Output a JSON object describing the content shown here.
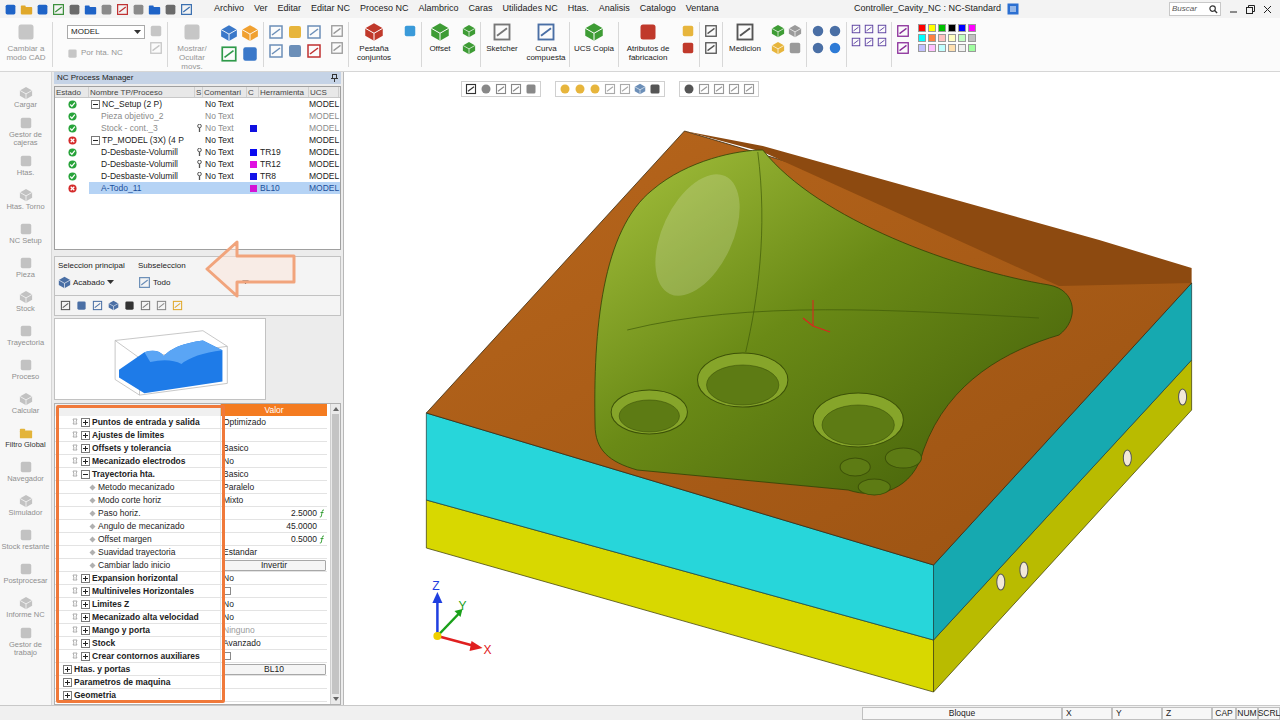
{
  "window": {
    "title": "Controller_Cavity_NC : NC-Standard"
  },
  "menu": [
    "Archivo",
    "Ver",
    "Editar",
    "Editar NC",
    "Proceso NC",
    "Alambrico",
    "Caras",
    "Utilidades NC",
    "Htas.",
    "Analisis",
    "Catalogo",
    "Ventana"
  ],
  "search": {
    "placeholder": "Buscar"
  },
  "ribbon": {
    "mode_button": {
      "label": "Cambiar a modo CAD",
      "disabled": true
    },
    "model_select": "MODEL",
    "tool_filter": {
      "label": "Por hta. NC",
      "disabled": true
    },
    "tools": [
      {
        "label": "Mostrar/ Ocultar movs.",
        "disabled": true
      },
      {
        "label": "Pestaña conjuntos",
        "disabled": false
      },
      {
        "label": "Offset",
        "disabled": false
      },
      {
        "label": "Sketcher",
        "disabled": false
      },
      {
        "label": "Curva compuesta",
        "disabled": false
      },
      {
        "label": "UCS Copia",
        "disabled": false
      },
      {
        "label": "Atributos de fabricacion",
        "disabled": false
      },
      {
        "label": "Medicion",
        "disabled": false
      }
    ]
  },
  "sidebar": {
    "items": [
      {
        "label": "Cargar",
        "enabled": false
      },
      {
        "label": "Gestor de cajeras",
        "enabled": false
      },
      {
        "label": "Htas.",
        "enabled": false
      },
      {
        "label": "Htas. Torno",
        "enabled": false
      },
      {
        "label": "NC Setup",
        "enabled": false
      },
      {
        "label": "Pieza",
        "enabled": false
      },
      {
        "label": "Stock",
        "enabled": false
      },
      {
        "label": "Trayectoria",
        "enabled": false
      },
      {
        "label": "Proceso",
        "enabled": false
      },
      {
        "label": "Calcular",
        "enabled": false
      },
      {
        "label": "Filtro Global",
        "enabled": true
      },
      {
        "label": "Navegador",
        "enabled": false
      },
      {
        "label": "Simulador",
        "enabled": false
      },
      {
        "label": "Stock restante",
        "enabled": false
      },
      {
        "label": "Postprocesar",
        "enabled": false
      },
      {
        "label": "Informe NC",
        "enabled": false
      },
      {
        "label": "Gestor de trabajo",
        "enabled": false
      }
    ]
  },
  "process_manager": {
    "title": "NC Process Manager",
    "columns": [
      "Estado",
      "Nombre TP/Proceso",
      "S",
      "Comentari",
      "C",
      "Herramienta",
      "UCS"
    ],
    "rows": [
      {
        "status": "ok",
        "name": "NC_Setup (2 P)",
        "depth": 0,
        "group": true,
        "expanded": true,
        "wrench": false,
        "comment": "No Text",
        "color": null,
        "tool": "",
        "ucs": "MODEL",
        "disabled": false,
        "selected": false
      },
      {
        "status": "ok",
        "name": "Pieza objetivo_2",
        "depth": 1,
        "group": false,
        "expanded": false,
        "wrench": false,
        "comment": "No Text",
        "color": null,
        "tool": "",
        "ucs": "MODEL",
        "disabled": true,
        "selected": false
      },
      {
        "status": "ok",
        "name": "Stock - cont._3",
        "depth": 1,
        "group": false,
        "expanded": false,
        "wrench": true,
        "comment": "No Text",
        "color": "#1010e0",
        "tool": "",
        "ucs": "MODEL",
        "disabled": true,
        "selected": false
      },
      {
        "status": "error",
        "name": "TP_MODEL (3X) (4 P",
        "depth": 0,
        "group": true,
        "expanded": true,
        "wrench": false,
        "comment": "No Text",
        "color": null,
        "tool": "",
        "ucs": "MODEL",
        "disabled": false,
        "selected": false
      },
      {
        "status": "ok",
        "name": "D-Desbaste-Volumill",
        "depth": 1,
        "group": false,
        "expanded": false,
        "wrench": true,
        "comment": "No Text",
        "color": "#0a0af0",
        "tool": "TR19",
        "ucs": "MODEL",
        "disabled": false,
        "selected": false
      },
      {
        "status": "ok",
        "name": "D-Desbaste-Volumill",
        "depth": 1,
        "group": false,
        "expanded": false,
        "wrench": true,
        "comment": "No Text",
        "color": "#e010e0",
        "tool": "TR12",
        "ucs": "MODEL",
        "disabled": false,
        "selected": false
      },
      {
        "status": "ok",
        "name": "D-Desbaste-Volumill",
        "depth": 1,
        "group": false,
        "expanded": false,
        "wrench": true,
        "comment": "No Text",
        "color": "#1414e8",
        "tool": "TR8",
        "ucs": "MODEL",
        "disabled": false,
        "selected": false
      },
      {
        "status": "error",
        "name": "A-Todo_11",
        "depth": 1,
        "group": false,
        "expanded": false,
        "wrench": false,
        "comment": "",
        "color": "#d414d4",
        "tool": "BL10",
        "ucs": "MODEL",
        "disabled": false,
        "selected": true
      }
    ]
  },
  "selection": {
    "primary_label": "Seleccion principal",
    "primary_value": "Acabado",
    "sub_label": "Subseleccion",
    "sub_value": "Todo"
  },
  "property_grid": {
    "value_header": "Valor",
    "rows": [
      {
        "label": "Puntos de entrada y salida",
        "value": "Optimizado",
        "kind": "group",
        "depth": 1,
        "expanded": false,
        "value_kind": "text",
        "checked": false,
        "formula": false,
        "disabled": false
      },
      {
        "label": "Ajustes de limites",
        "value": "",
        "kind": "group",
        "depth": 1,
        "expanded": false,
        "value_kind": "none",
        "checked": false,
        "formula": false,
        "disabled": false
      },
      {
        "label": "Offsets y tolerancia",
        "value": "Basico",
        "kind": "group",
        "depth": 1,
        "expanded": false,
        "value_kind": "text",
        "checked": false,
        "formula": false,
        "disabled": false
      },
      {
        "label": "Mecanizado electrodos",
        "value": "No",
        "kind": "group",
        "depth": 1,
        "expanded": false,
        "value_kind": "text",
        "checked": false,
        "formula": false,
        "disabled": false
      },
      {
        "label": "Trayectoria hta.",
        "value": "Basico",
        "kind": "group",
        "depth": 1,
        "expanded": true,
        "value_kind": "text",
        "checked": false,
        "formula": false,
        "disabled": false
      },
      {
        "label": "Metodo mecanizado",
        "value": "Paralelo",
        "kind": "param",
        "depth": 2,
        "expanded": false,
        "value_kind": "text",
        "checked": false,
        "formula": false,
        "disabled": false
      },
      {
        "label": "Modo corte horiz",
        "value": "Mixto",
        "kind": "param",
        "depth": 2,
        "expanded": false,
        "value_kind": "text",
        "checked": false,
        "formula": false,
        "disabled": false
      },
      {
        "label": "Paso horiz.",
        "value": "2.5000",
        "kind": "param",
        "depth": 2,
        "expanded": false,
        "value_kind": "text",
        "checked": false,
        "formula": true,
        "disabled": false
      },
      {
        "label": "Angulo de mecanizado",
        "value": "45.0000",
        "kind": "param",
        "depth": 2,
        "expanded": false,
        "value_kind": "text",
        "checked": false,
        "formula": false,
        "disabled": false
      },
      {
        "label": "Offset margen",
        "value": "0.5000",
        "kind": "param",
        "depth": 2,
        "expanded": false,
        "value_kind": "text",
        "checked": false,
        "formula": true,
        "disabled": false
      },
      {
        "label": "Suavidad trayectoria",
        "value": "Estandar",
        "kind": "param",
        "depth": 2,
        "expanded": false,
        "value_kind": "text",
        "checked": false,
        "formula": false,
        "disabled": false
      },
      {
        "label": "Cambiar lado inicio",
        "value": "Invertir",
        "kind": "param",
        "depth": 2,
        "expanded": false,
        "value_kind": "button",
        "checked": false,
        "formula": false,
        "disabled": false
      },
      {
        "label": "Expansion horizontal",
        "value": "No",
        "kind": "group",
        "depth": 1,
        "expanded": false,
        "value_kind": "text",
        "checked": false,
        "formula": false,
        "disabled": false
      },
      {
        "label": "Multiniveles Horizontales",
        "value": "",
        "kind": "group",
        "depth": 1,
        "expanded": false,
        "value_kind": "checkbox",
        "checked": false,
        "formula": false,
        "disabled": false
      },
      {
        "label": "Limites Z",
        "value": "No",
        "kind": "group",
        "depth": 1,
        "expanded": false,
        "value_kind": "text",
        "checked": false,
        "formula": false,
        "disabled": false
      },
      {
        "label": "Mecanizado alta velocidad",
        "value": "No",
        "kind": "group",
        "depth": 1,
        "expanded": false,
        "value_kind": "text",
        "checked": false,
        "formula": false,
        "disabled": false
      },
      {
        "label": "Mango y porta",
        "value": "Ninguno",
        "kind": "group",
        "depth": 1,
        "expanded": false,
        "value_kind": "text",
        "checked": false,
        "formula": false,
        "disabled": true
      },
      {
        "label": "Stock",
        "value": "Avanzado",
        "kind": "group",
        "depth": 1,
        "expanded": false,
        "value_kind": "text",
        "checked": false,
        "formula": false,
        "disabled": false
      },
      {
        "label": "Crear contornos auxiliares",
        "value": "",
        "kind": "group",
        "depth": 1,
        "expanded": false,
        "value_kind": "checkbox",
        "checked": false,
        "formula": false,
        "disabled": false
      },
      {
        "label": "Htas. y portas",
        "value": "BL10",
        "kind": "group",
        "depth": 0,
        "expanded": false,
        "value_kind": "button",
        "checked": false,
        "formula": false,
        "disabled": false
      },
      {
        "label": "Parametros de maquina",
        "value": "",
        "kind": "group",
        "depth": 0,
        "expanded": false,
        "value_kind": "none",
        "checked": false,
        "formula": false,
        "disabled": false
      },
      {
        "label": "Geometria",
        "value": "",
        "kind": "group",
        "depth": 0,
        "expanded": false,
        "value_kind": "none",
        "checked": false,
        "formula": false,
        "disabled": false
      }
    ]
  },
  "viewport": {
    "axes": {
      "x": "X",
      "y": "Y",
      "z": "Z"
    }
  },
  "status_bar": {
    "fields": [
      "Bloque",
      "X",
      "Y",
      "Z"
    ],
    "indicators": [
      "CAP",
      "NUM",
      "SCRL"
    ]
  }
}
